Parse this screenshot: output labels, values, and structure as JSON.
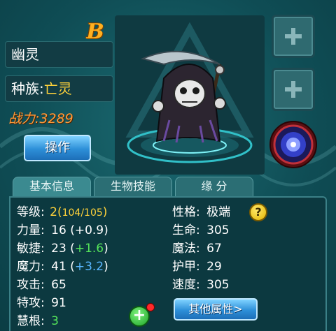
{
  "header": {
    "rank": "B",
    "name": "幽灵",
    "race_label": "种族:",
    "race_value": "亡灵",
    "power": "战力:3289",
    "operate_label": "操作"
  },
  "tabs": [
    {
      "label": "基本信息"
    },
    {
      "label": "生物技能"
    },
    {
      "label": "缘 分"
    }
  ],
  "stats_left": [
    {
      "label": "等级:",
      "value": "2",
      "extra_open": "(",
      "extra": "104/105",
      "extra_close": ")"
    },
    {
      "label": "力量:",
      "value": "16",
      "bonus": "(+0.9)"
    },
    {
      "label": "敏捷:",
      "value": "23",
      "bonus_open": " (",
      "bonus": "+1.6",
      "bonus_close": ")"
    },
    {
      "label": "魔力:",
      "value": "41",
      "bonus_open": " (",
      "bonus": "+3.2",
      "bonus_close": ")"
    },
    {
      "label": "攻击:",
      "value": "65"
    },
    {
      "label": "特攻:",
      "value": "91"
    },
    {
      "label": "慧根:",
      "value": "3"
    }
  ],
  "stats_right": [
    {
      "label": "性格:",
      "value": "极端"
    },
    {
      "label": "生命:",
      "value": "305"
    },
    {
      "label": "魔法:",
      "value": "67"
    },
    {
      "label": "护甲:",
      "value": "29"
    },
    {
      "label": "速度:",
      "value": "305"
    }
  ],
  "help_label": "?",
  "add_label": "+",
  "more_label": "其他属性>",
  "icons": [
    "plus-icon",
    "eye-orb-icon",
    "help-icon",
    "add-icon",
    "reaper-portrait"
  ],
  "colors": {
    "accent_gold": "#ffd23a",
    "power_orange": "#ff9a3a",
    "bonus_green": "#55e45a",
    "bonus_blue": "#59b6ff",
    "button_blue": "#2d8fd8"
  }
}
